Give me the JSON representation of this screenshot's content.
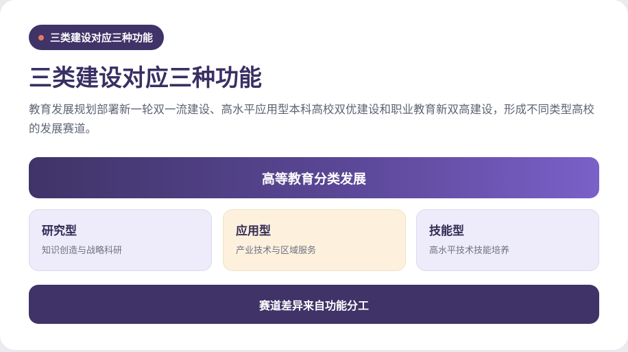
{
  "tag": {
    "label": "三类建设对应三种功能",
    "dot_color": "#e8785a"
  },
  "title": "三类建设对应三种功能",
  "description": "教育发展规划部署新一轮双一流建设、高水平应用型本科高校双优建设和职业教育新双高建设，形成不同类型高校的发展赛道。",
  "banner": {
    "label": "高等教育分类发展"
  },
  "types": [
    {
      "title": "研究型",
      "subtitle": "知识创造与战略科研",
      "color": "#eeebfa"
    },
    {
      "title": "应用型",
      "subtitle": "产业技术与区域服务",
      "color": "#fdf1dd"
    },
    {
      "title": "技能型",
      "subtitle": "高水平技术技能培养",
      "color": "#eeebfa"
    }
  ],
  "footer": {
    "label": "赛道差异来自功能分工"
  },
  "colors": {
    "primary": "#3f3368",
    "accent": "#7a60c8",
    "title": "#3a2f63",
    "text": "#5d6474"
  }
}
